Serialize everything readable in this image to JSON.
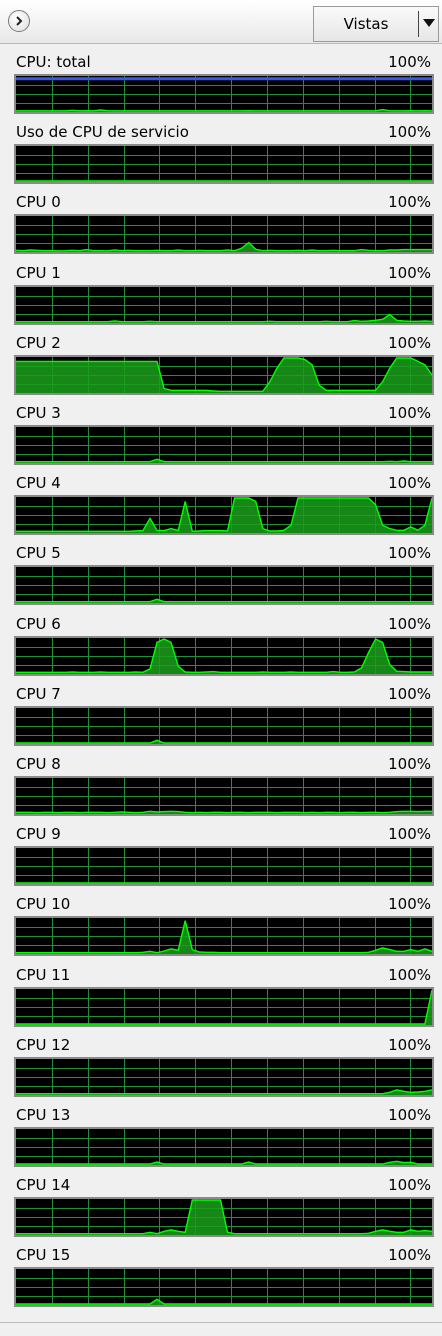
{
  "toolbar": {
    "expand_icon": "chevron-right-circle-icon",
    "views_label": "Vistas",
    "views_dropdown_icon": "triangle-down-icon"
  },
  "colors": {
    "graph_background": "#000000",
    "grid_line": "#1f8f3a",
    "cpu_line": "#00ff00",
    "cpu_fill": "#1b9f1b",
    "service_line": "#3a57e8"
  },
  "panels": [
    {
      "label": "CPU: total",
      "max_label": "100%",
      "values": [
        0.5,
        0.5,
        0.5,
        0.5,
        0.5,
        0.5,
        0.5,
        0.5,
        2,
        0.5,
        1,
        0.5,
        3,
        1,
        0.5,
        0.5,
        0.5,
        0.5,
        0.5,
        0.5,
        0.5,
        0.5,
        0.5,
        0.5,
        0.5,
        0.5,
        0.5,
        0.5,
        0.5,
        0.5,
        0.5,
        0.5,
        0.5,
        1,
        0.5,
        0.5,
        0.5,
        0.5,
        0.5,
        0.5,
        0.5,
        0.5,
        0.5,
        0.5,
        0.5,
        0.5,
        0.5,
        0.5,
        0.5,
        0.5,
        0.5,
        0.5,
        4,
        1,
        0.5,
        0.5,
        1,
        0.5,
        1,
        0.5
      ],
      "top_line": 95
    },
    {
      "label": "Uso de CPU de servicio",
      "max_label": "100%",
      "values": [
        0,
        0,
        0,
        0,
        0,
        0,
        0,
        0,
        0,
        0,
        0,
        0,
        0,
        0,
        0,
        0,
        0,
        0,
        0,
        0,
        0,
        0,
        0,
        0,
        0,
        0,
        0,
        0,
        0,
        0,
        0,
        0,
        0,
        0,
        0,
        0,
        0,
        0,
        0,
        0,
        0,
        0,
        0,
        0,
        0,
        0,
        0,
        0,
        0,
        0,
        0,
        0,
        0,
        0,
        0,
        0,
        0,
        0,
        0,
        0
      ]
    },
    {
      "label": "CPU 0",
      "max_label": "100%",
      "values": [
        2,
        1,
        3,
        2,
        1,
        1,
        0.5,
        1,
        2,
        1,
        4,
        1,
        1,
        0.5,
        3,
        1,
        2,
        1,
        1,
        1,
        2,
        1,
        1,
        3,
        1,
        1,
        2,
        1,
        1,
        1,
        3,
        1,
        8,
        25,
        5,
        1,
        2,
        1,
        1,
        1,
        2,
        1,
        3,
        1,
        1,
        2,
        1,
        1,
        1,
        4,
        2,
        1,
        1,
        3,
        3,
        4,
        4,
        4,
        4,
        4
      ]
    },
    {
      "label": "CPU 1",
      "max_label": "100%",
      "values": [
        1,
        1,
        1,
        1,
        1,
        1,
        1,
        1,
        1,
        1,
        1,
        1,
        1,
        1,
        3,
        1,
        1,
        1,
        1,
        2,
        1,
        1,
        1,
        1,
        1,
        1,
        1,
        1,
        1,
        1,
        1,
        1,
        1,
        1,
        1,
        1,
        2,
        1,
        1,
        1,
        1,
        1,
        1,
        1,
        2,
        1,
        1,
        1,
        4,
        2,
        3,
        5,
        8,
        22,
        5,
        3,
        2,
        2,
        3,
        2
      ]
    },
    {
      "label": "CPU 2",
      "max_label": "100%",
      "values": [
        90,
        90,
        90,
        90,
        90,
        90,
        90,
        90,
        90,
        90,
        90,
        90,
        90,
        90,
        90,
        90,
        90,
        90,
        90,
        90,
        90,
        10,
        5,
        5,
        5,
        5,
        5,
        5,
        3,
        2,
        2,
        2,
        2,
        2,
        2,
        2,
        30,
        70,
        100,
        100,
        100,
        95,
        80,
        20,
        5,
        5,
        5,
        5,
        5,
        5,
        5,
        5,
        30,
        70,
        100,
        100,
        100,
        90,
        80,
        50
      ]
    },
    {
      "label": "CPU 3",
      "max_label": "100%",
      "values": [
        1,
        1,
        1,
        1,
        1,
        1,
        1,
        1,
        1,
        1,
        1,
        1,
        1,
        1,
        1,
        1,
        1,
        1,
        1,
        1,
        8,
        1,
        1,
        1,
        1,
        1,
        1,
        1,
        1,
        1,
        1,
        1,
        1,
        1,
        1,
        1,
        1,
        1,
        1,
        1,
        1,
        1,
        1,
        1,
        1,
        1,
        1,
        1,
        1,
        1,
        1,
        1,
        1,
        2,
        1,
        3,
        1,
        1,
        1,
        1
      ]
    },
    {
      "label": "CPU 4",
      "max_label": "100%",
      "values": [
        2,
        2,
        2,
        2,
        2,
        2,
        2,
        2,
        2,
        2,
        2,
        2,
        2,
        2,
        2,
        2,
        2,
        3,
        4,
        40,
        5,
        4,
        10,
        4,
        90,
        2,
        3,
        4,
        4,
        4,
        3,
        100,
        100,
        100,
        90,
        10,
        3,
        3,
        5,
        20,
        100,
        100,
        100,
        100,
        100,
        100,
        100,
        100,
        100,
        100,
        100,
        80,
        20,
        10,
        5,
        5,
        15,
        5,
        20,
        100
      ]
    },
    {
      "label": "CPU 5",
      "max_label": "100%",
      "values": [
        1,
        1,
        1,
        1,
        1,
        1,
        1,
        1,
        1,
        1,
        1,
        1,
        1,
        1,
        1,
        1,
        1,
        1,
        1,
        1,
        8,
        1,
        1,
        1,
        1,
        1,
        1,
        1,
        1,
        1,
        1,
        1,
        1,
        1,
        1,
        1,
        1,
        1,
        1,
        1,
        1,
        1,
        1,
        1,
        1,
        1,
        1,
        1,
        1,
        1,
        1,
        1,
        1,
        1,
        1,
        1,
        1,
        1,
        1,
        1
      ]
    },
    {
      "label": "CPU 6",
      "max_label": "100%",
      "values": [
        2,
        2,
        2,
        2,
        2,
        2,
        2,
        2,
        3,
        2,
        2,
        2,
        3,
        2,
        2,
        2,
        2,
        3,
        2,
        12,
        90,
        100,
        90,
        20,
        3,
        2,
        2,
        3,
        4,
        2,
        2,
        2,
        2,
        2,
        2,
        3,
        2,
        2,
        2,
        3,
        2,
        2,
        2,
        2,
        2,
        4,
        2,
        2,
        3,
        15,
        60,
        100,
        90,
        25,
        5,
        4,
        3,
        3,
        3,
        3
      ]
    },
    {
      "label": "CPU 7",
      "max_label": "100%",
      "values": [
        0,
        0,
        0,
        0,
        0,
        0,
        0,
        0,
        0,
        0,
        0,
        0,
        0,
        0,
        0,
        0,
        0,
        0,
        0,
        0,
        8,
        0,
        0,
        0,
        0,
        0,
        0,
        0,
        0,
        0,
        0,
        0,
        0,
        0,
        0,
        0,
        0,
        0,
        0,
        0,
        0,
        0,
        0,
        0,
        0,
        0,
        0,
        0,
        0,
        0,
        0,
        0,
        0,
        0,
        0,
        0,
        0,
        0,
        0,
        0
      ]
    },
    {
      "label": "CPU 8",
      "max_label": "100%",
      "values": [
        2,
        2,
        2,
        1,
        2,
        2,
        1,
        2,
        2,
        1,
        2,
        2,
        2,
        1,
        2,
        3,
        2,
        1,
        2,
        5,
        3,
        4,
        5,
        4,
        2,
        1,
        2,
        1,
        2,
        2,
        1,
        2,
        2,
        1,
        2,
        2,
        2,
        1,
        2,
        2,
        2,
        1,
        2,
        1,
        2,
        2,
        1,
        2,
        2,
        1,
        2,
        2,
        1,
        2,
        4,
        5,
        5,
        4,
        5,
        5
      ]
    },
    {
      "label": "CPU 9",
      "max_label": "100%",
      "values": [
        0,
        0,
        0,
        0,
        0,
        0,
        0,
        0,
        0,
        0,
        0,
        0,
        0,
        0,
        0,
        0,
        0,
        0,
        0,
        0,
        0,
        0,
        0,
        0,
        0,
        0,
        0,
        0,
        0,
        0,
        0,
        0,
        0,
        0,
        0,
        0,
        0,
        0,
        0,
        0,
        0,
        0,
        0,
        0,
        0,
        0,
        0,
        0,
        0,
        0,
        0,
        0,
        0,
        0,
        0,
        0,
        0,
        0,
        0,
        0
      ]
    },
    {
      "label": "CPU 10",
      "max_label": "100%",
      "values": [
        1,
        1,
        1,
        1,
        1,
        1,
        1,
        1,
        1,
        1,
        1,
        1,
        1,
        1,
        1,
        1,
        1,
        1,
        2,
        5,
        1,
        6,
        12,
        8,
        95,
        10,
        3,
        2,
        2,
        1,
        1,
        1,
        1,
        1,
        1,
        1,
        1,
        1,
        1,
        1,
        1,
        1,
        1,
        1,
        1,
        1,
        1,
        1,
        1,
        1,
        2,
        8,
        15,
        10,
        5,
        5,
        10,
        5,
        12,
        5
      ]
    },
    {
      "label": "CPU 11",
      "max_label": "100%",
      "values": [
        0,
        0,
        0,
        0,
        0,
        0,
        0,
        0,
        0,
        0,
        0,
        0,
        0,
        0,
        0,
        0,
        0,
        0,
        0,
        0,
        0,
        0,
        0,
        0,
        0,
        0,
        0,
        0,
        0,
        0,
        0,
        0,
        0,
        0,
        0,
        0,
        0,
        0,
        0,
        0,
        0,
        0,
        0,
        0,
        0,
        0,
        0,
        0,
        0,
        0,
        0,
        0,
        0,
        0,
        0,
        0,
        0,
        0,
        0,
        100
      ]
    },
    {
      "label": "CPU 12",
      "max_label": "100%",
      "values": [
        1,
        1,
        1,
        1,
        1,
        1,
        1,
        1,
        1,
        1,
        1,
        1,
        1,
        1,
        1,
        1,
        1,
        1,
        1,
        1,
        1,
        1,
        1,
        1,
        1,
        1,
        1,
        1,
        1,
        1,
        1,
        1,
        1,
        1,
        1,
        1,
        1,
        1,
        1,
        1,
        1,
        1,
        1,
        1,
        1,
        1,
        1,
        1,
        1,
        1,
        1,
        1,
        1,
        5,
        12,
        8,
        5,
        6,
        8,
        12
      ]
    },
    {
      "label": "CPU 13",
      "max_label": "100%",
      "values": [
        0,
        0,
        0,
        0,
        0,
        0,
        0,
        0,
        0,
        0,
        0,
        0,
        0,
        0,
        0,
        0,
        0,
        0,
        0,
        0,
        6,
        0,
        0,
        0,
        0,
        0,
        0,
        0,
        0,
        0,
        0,
        0,
        0,
        6,
        0,
        0,
        0,
        0,
        0,
        0,
        0,
        0,
        0,
        0,
        0,
        0,
        0,
        0,
        0,
        0,
        0,
        0,
        0,
        5,
        8,
        4,
        5,
        0,
        0,
        0
      ]
    },
    {
      "label": "CPU 14",
      "max_label": "100%",
      "values": [
        1,
        1,
        1,
        1,
        1,
        1,
        1,
        1,
        1,
        1,
        1,
        1,
        1,
        1,
        1,
        1,
        1,
        1,
        1,
        5,
        1,
        8,
        12,
        8,
        5,
        100,
        100,
        100,
        100,
        100,
        5,
        1,
        1,
        1,
        1,
        1,
        1,
        1,
        1,
        1,
        1,
        1,
        1,
        1,
        1,
        1,
        1,
        1,
        1,
        1,
        2,
        8,
        12,
        8,
        5,
        5,
        12,
        8,
        10,
        8
      ]
    },
    {
      "label": "CPU 15",
      "max_label": "100%",
      "values": [
        0,
        0,
        0,
        0,
        0,
        0,
        0,
        0,
        0,
        0,
        0,
        0,
        0,
        0,
        0,
        0,
        0,
        0,
        0,
        0,
        14,
        0,
        0,
        0,
        0,
        0,
        0,
        0,
        0,
        0,
        0,
        0,
        0,
        0,
        0,
        0,
        0,
        0,
        0,
        0,
        0,
        0,
        0,
        0,
        0,
        0,
        0,
        0,
        0,
        0,
        0,
        0,
        0,
        0,
        0,
        0,
        0,
        0,
        0,
        0
      ]
    }
  ]
}
